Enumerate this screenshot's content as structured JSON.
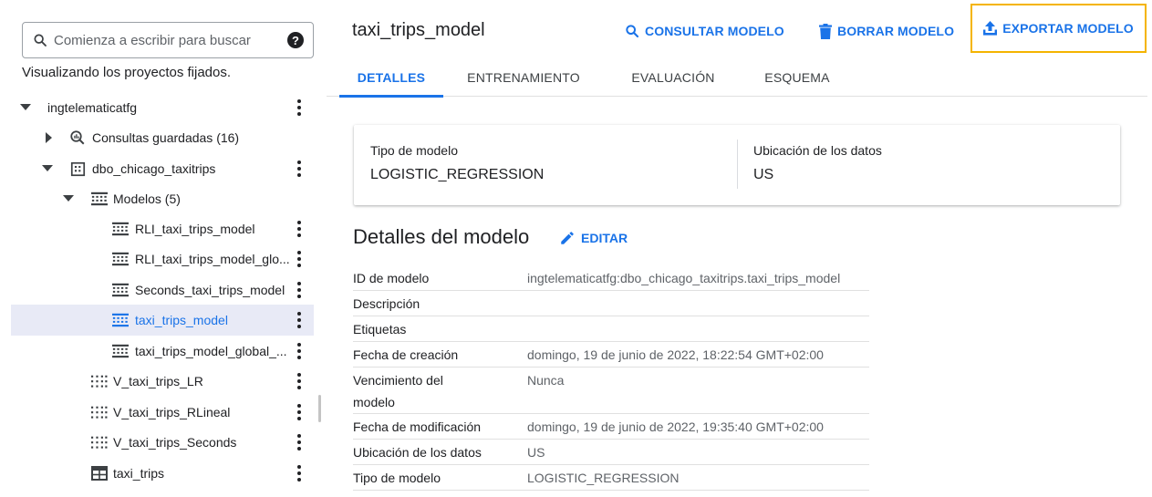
{
  "search": {
    "placeholder": "Comienza a escribir para buscar",
    "help_icon": "?"
  },
  "pinned_text": "Visualizando los proyectos fijados.",
  "tree": [
    {
      "label": "ingtelematicatfg",
      "caret": "down",
      "icon": "none",
      "indent": 0,
      "kebab": true
    },
    {
      "label": "Consultas guardadas (16)",
      "caret": "right",
      "icon": "saved-query-icon",
      "indent": 1,
      "kebab": false
    },
    {
      "label": "dbo_chicago_taxitrips",
      "caret": "down",
      "icon": "dataset-icon",
      "indent": 1,
      "kebab": true
    },
    {
      "label": "Modelos (5)",
      "caret": "down",
      "icon": "model-icon",
      "indent": 2,
      "kebab": false
    },
    {
      "label": "RLI_taxi_trips_model",
      "caret": "none",
      "icon": "model-icon",
      "indent": 3,
      "kebab": true
    },
    {
      "label": "RLI_taxi_trips_model_glo...",
      "caret": "none",
      "icon": "model-icon",
      "indent": 3,
      "kebab": true
    },
    {
      "label": "Seconds_taxi_trips_model",
      "caret": "none",
      "icon": "model-icon",
      "indent": 3,
      "kebab": true
    },
    {
      "label": "taxi_trips_model",
      "caret": "none",
      "icon": "model-icon",
      "indent": 3,
      "kebab": true,
      "selected": true
    },
    {
      "label": "taxi_trips_model_global_...",
      "caret": "none",
      "icon": "model-icon",
      "indent": 3,
      "kebab": true
    },
    {
      "label": "V_taxi_trips_LR",
      "caret": "none",
      "icon": "view-icon",
      "indent": 2,
      "kebab": true
    },
    {
      "label": "V_taxi_trips_RLineal",
      "caret": "none",
      "icon": "view-icon",
      "indent": 2,
      "kebab": true
    },
    {
      "label": "V_taxi_trips_Seconds",
      "caret": "none",
      "icon": "view-icon",
      "indent": 2,
      "kebab": true
    },
    {
      "label": "taxi_trips",
      "caret": "none",
      "icon": "table-icon",
      "indent": 2,
      "kebab": true
    }
  ],
  "header": {
    "title": "taxi_trips_model",
    "query_label": "CONSULTAR MODELO",
    "delete_label": "BORRAR MODELO",
    "export_label": "EXPORTAR MODELO"
  },
  "tabs": [
    {
      "label": "DETALLES",
      "active": true
    },
    {
      "label": "ENTRENAMIENTO",
      "active": false
    },
    {
      "label": "EVALUACIÓN",
      "active": false
    },
    {
      "label": "ESQUEMA",
      "active": false
    }
  ],
  "info_card": {
    "type_key": "Tipo de modelo",
    "type_value": "LOGISTIC_REGRESSION",
    "location_key": "Ubicación de los datos",
    "location_value": "US"
  },
  "details_section": {
    "title": "Detalles del modelo",
    "edit_label": "EDITAR",
    "rows": [
      {
        "key": "ID de modelo",
        "value": "ingtelematicatfg:dbo_chicago_taxitrips.taxi_trips_model"
      },
      {
        "key": "Descripción",
        "value": ""
      },
      {
        "key": "Etiquetas",
        "value": ""
      },
      {
        "key": "Fecha de creación",
        "value": "domingo, 19 de junio de 2022, 18:22:54 GMT+02:00"
      },
      {
        "key_line1": "Vencimiento del",
        "key_line2": "modelo",
        "value": "Nunca"
      },
      {
        "key": "Fecha de modificación",
        "value": "domingo, 19 de junio de 2022, 19:35:40 GMT+02:00"
      },
      {
        "key": "Ubicación de los datos",
        "value": "US"
      },
      {
        "key": "Tipo de modelo",
        "value": "LOGISTIC_REGRESSION"
      }
    ]
  },
  "colors": {
    "accent": "#1a73e8",
    "highlight_border": "#f4b400",
    "selected_row": "#e8eaf6"
  }
}
